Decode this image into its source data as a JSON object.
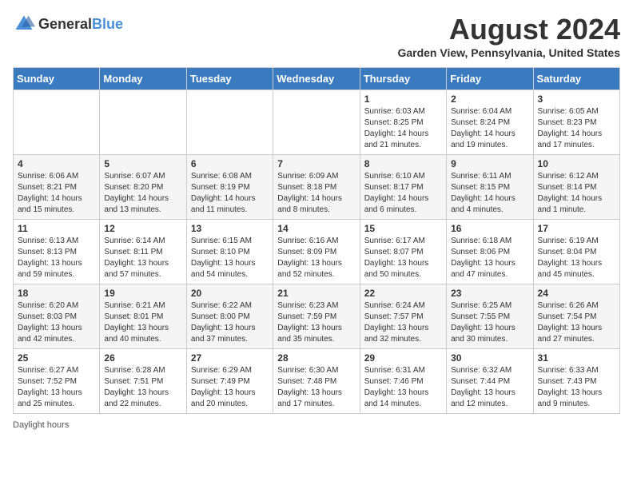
{
  "header": {
    "logo": {
      "general": "General",
      "blue": "Blue"
    },
    "title": "August 2024",
    "location": "Garden View, Pennsylvania, United States"
  },
  "footer": {
    "daylight_hours": "Daylight hours"
  },
  "weekdays": [
    "Sunday",
    "Monday",
    "Tuesday",
    "Wednesday",
    "Thursday",
    "Friday",
    "Saturday"
  ],
  "weeks": [
    [
      {
        "day": "",
        "info": ""
      },
      {
        "day": "",
        "info": ""
      },
      {
        "day": "",
        "info": ""
      },
      {
        "day": "",
        "info": ""
      },
      {
        "day": "1",
        "info": "Sunrise: 6:03 AM\nSunset: 8:25 PM\nDaylight: 14 hours\nand 21 minutes."
      },
      {
        "day": "2",
        "info": "Sunrise: 6:04 AM\nSunset: 8:24 PM\nDaylight: 14 hours\nand 19 minutes."
      },
      {
        "day": "3",
        "info": "Sunrise: 6:05 AM\nSunset: 8:23 PM\nDaylight: 14 hours\nand 17 minutes."
      }
    ],
    [
      {
        "day": "4",
        "info": "Sunrise: 6:06 AM\nSunset: 8:21 PM\nDaylight: 14 hours\nand 15 minutes."
      },
      {
        "day": "5",
        "info": "Sunrise: 6:07 AM\nSunset: 8:20 PM\nDaylight: 14 hours\nand 13 minutes."
      },
      {
        "day": "6",
        "info": "Sunrise: 6:08 AM\nSunset: 8:19 PM\nDaylight: 14 hours\nand 11 minutes."
      },
      {
        "day": "7",
        "info": "Sunrise: 6:09 AM\nSunset: 8:18 PM\nDaylight: 14 hours\nand 8 minutes."
      },
      {
        "day": "8",
        "info": "Sunrise: 6:10 AM\nSunset: 8:17 PM\nDaylight: 14 hours\nand 6 minutes."
      },
      {
        "day": "9",
        "info": "Sunrise: 6:11 AM\nSunset: 8:15 PM\nDaylight: 14 hours\nand 4 minutes."
      },
      {
        "day": "10",
        "info": "Sunrise: 6:12 AM\nSunset: 8:14 PM\nDaylight: 14 hours\nand 1 minute."
      }
    ],
    [
      {
        "day": "11",
        "info": "Sunrise: 6:13 AM\nSunset: 8:13 PM\nDaylight: 13 hours\nand 59 minutes."
      },
      {
        "day": "12",
        "info": "Sunrise: 6:14 AM\nSunset: 8:11 PM\nDaylight: 13 hours\nand 57 minutes."
      },
      {
        "day": "13",
        "info": "Sunrise: 6:15 AM\nSunset: 8:10 PM\nDaylight: 13 hours\nand 54 minutes."
      },
      {
        "day": "14",
        "info": "Sunrise: 6:16 AM\nSunset: 8:09 PM\nDaylight: 13 hours\nand 52 minutes."
      },
      {
        "day": "15",
        "info": "Sunrise: 6:17 AM\nSunset: 8:07 PM\nDaylight: 13 hours\nand 50 minutes."
      },
      {
        "day": "16",
        "info": "Sunrise: 6:18 AM\nSunset: 8:06 PM\nDaylight: 13 hours\nand 47 minutes."
      },
      {
        "day": "17",
        "info": "Sunrise: 6:19 AM\nSunset: 8:04 PM\nDaylight: 13 hours\nand 45 minutes."
      }
    ],
    [
      {
        "day": "18",
        "info": "Sunrise: 6:20 AM\nSunset: 8:03 PM\nDaylight: 13 hours\nand 42 minutes."
      },
      {
        "day": "19",
        "info": "Sunrise: 6:21 AM\nSunset: 8:01 PM\nDaylight: 13 hours\nand 40 minutes."
      },
      {
        "day": "20",
        "info": "Sunrise: 6:22 AM\nSunset: 8:00 PM\nDaylight: 13 hours\nand 37 minutes."
      },
      {
        "day": "21",
        "info": "Sunrise: 6:23 AM\nSunset: 7:59 PM\nDaylight: 13 hours\nand 35 minutes."
      },
      {
        "day": "22",
        "info": "Sunrise: 6:24 AM\nSunset: 7:57 PM\nDaylight: 13 hours\nand 32 minutes."
      },
      {
        "day": "23",
        "info": "Sunrise: 6:25 AM\nSunset: 7:55 PM\nDaylight: 13 hours\nand 30 minutes."
      },
      {
        "day": "24",
        "info": "Sunrise: 6:26 AM\nSunset: 7:54 PM\nDaylight: 13 hours\nand 27 minutes."
      }
    ],
    [
      {
        "day": "25",
        "info": "Sunrise: 6:27 AM\nSunset: 7:52 PM\nDaylight: 13 hours\nand 25 minutes."
      },
      {
        "day": "26",
        "info": "Sunrise: 6:28 AM\nSunset: 7:51 PM\nDaylight: 13 hours\nand 22 minutes."
      },
      {
        "day": "27",
        "info": "Sunrise: 6:29 AM\nSunset: 7:49 PM\nDaylight: 13 hours\nand 20 minutes."
      },
      {
        "day": "28",
        "info": "Sunrise: 6:30 AM\nSunset: 7:48 PM\nDaylight: 13 hours\nand 17 minutes."
      },
      {
        "day": "29",
        "info": "Sunrise: 6:31 AM\nSunset: 7:46 PM\nDaylight: 13 hours\nand 14 minutes."
      },
      {
        "day": "30",
        "info": "Sunrise: 6:32 AM\nSunset: 7:44 PM\nDaylight: 13 hours\nand 12 minutes."
      },
      {
        "day": "31",
        "info": "Sunrise: 6:33 AM\nSunset: 7:43 PM\nDaylight: 13 hours\nand 9 minutes."
      }
    ]
  ]
}
